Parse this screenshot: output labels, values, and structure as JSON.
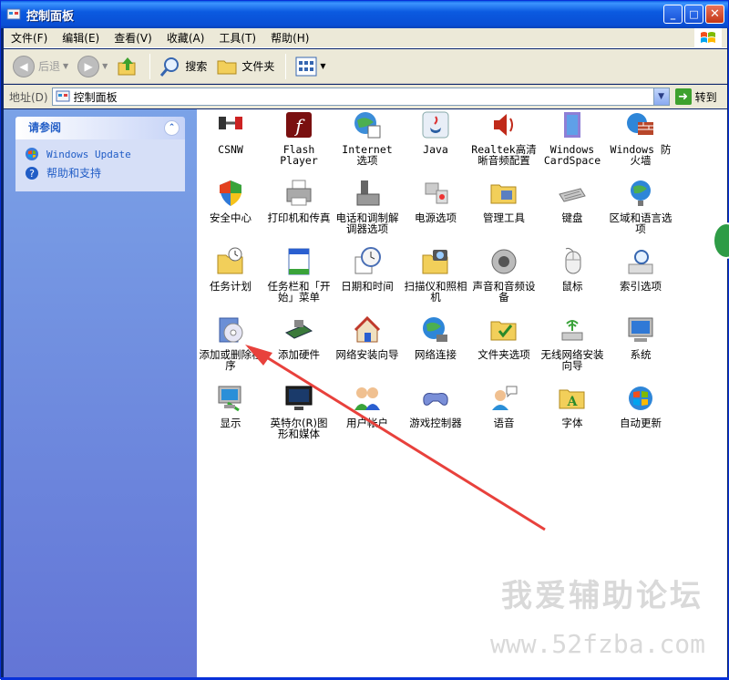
{
  "window": {
    "title": "控制面板",
    "buttons": [
      "_",
      "□",
      "✕"
    ]
  },
  "menubar": {
    "items": [
      "文件(F)",
      "编辑(E)",
      "查看(V)",
      "收藏(A)",
      "工具(T)",
      "帮助(H)"
    ]
  },
  "toolbar": {
    "back": "后退",
    "search": "搜索",
    "folders": "文件夹"
  },
  "address": {
    "label": "地址(D)",
    "value": "控制面板",
    "go": "转到"
  },
  "see_also": {
    "title": "请参阅",
    "links": [
      "Windows Update",
      "帮助和支持"
    ]
  },
  "items": [
    {
      "label": "CSNW"
    },
    {
      "label": "Flash Player"
    },
    {
      "label": "Internet 选项"
    },
    {
      "label": "Java"
    },
    {
      "label": "Realtek高清晰音频配置"
    },
    {
      "label": "Windows CardSpace"
    },
    {
      "label": "Windows 防火墙"
    },
    {
      "label": "安全中心"
    },
    {
      "label": "打印机和传真"
    },
    {
      "label": "电话和调制解调器选项"
    },
    {
      "label": "电源选项"
    },
    {
      "label": "管理工具"
    },
    {
      "label": "键盘"
    },
    {
      "label": "区域和语言选项"
    },
    {
      "label": "任务计划"
    },
    {
      "label": "任务栏和「开始」菜单"
    },
    {
      "label": "日期和时间"
    },
    {
      "label": "扫描仪和照相机"
    },
    {
      "label": "声音和音频设备"
    },
    {
      "label": "鼠标"
    },
    {
      "label": "索引选项"
    },
    {
      "label": "添加或删除程序"
    },
    {
      "label": "添加硬件"
    },
    {
      "label": "网络安装向导"
    },
    {
      "label": "网络连接"
    },
    {
      "label": "文件夹选项"
    },
    {
      "label": "无线网络安装向导"
    },
    {
      "label": "系统"
    },
    {
      "label": "显示"
    },
    {
      "label": "英特尔(R)图形和媒体"
    },
    {
      "label": "用户帐户"
    },
    {
      "label": "游戏控制器"
    },
    {
      "label": "语音"
    },
    {
      "label": "字体"
    },
    {
      "label": "自动更新"
    }
  ],
  "watermark": {
    "line1": "我爱辅助论坛",
    "line2": "www.52fzba.com"
  },
  "colors": {
    "titlebar": "#0a5fe3",
    "sidepane": "#6f8fe0",
    "link": "#215dc6",
    "annotation_arrow": "#e8413c"
  }
}
